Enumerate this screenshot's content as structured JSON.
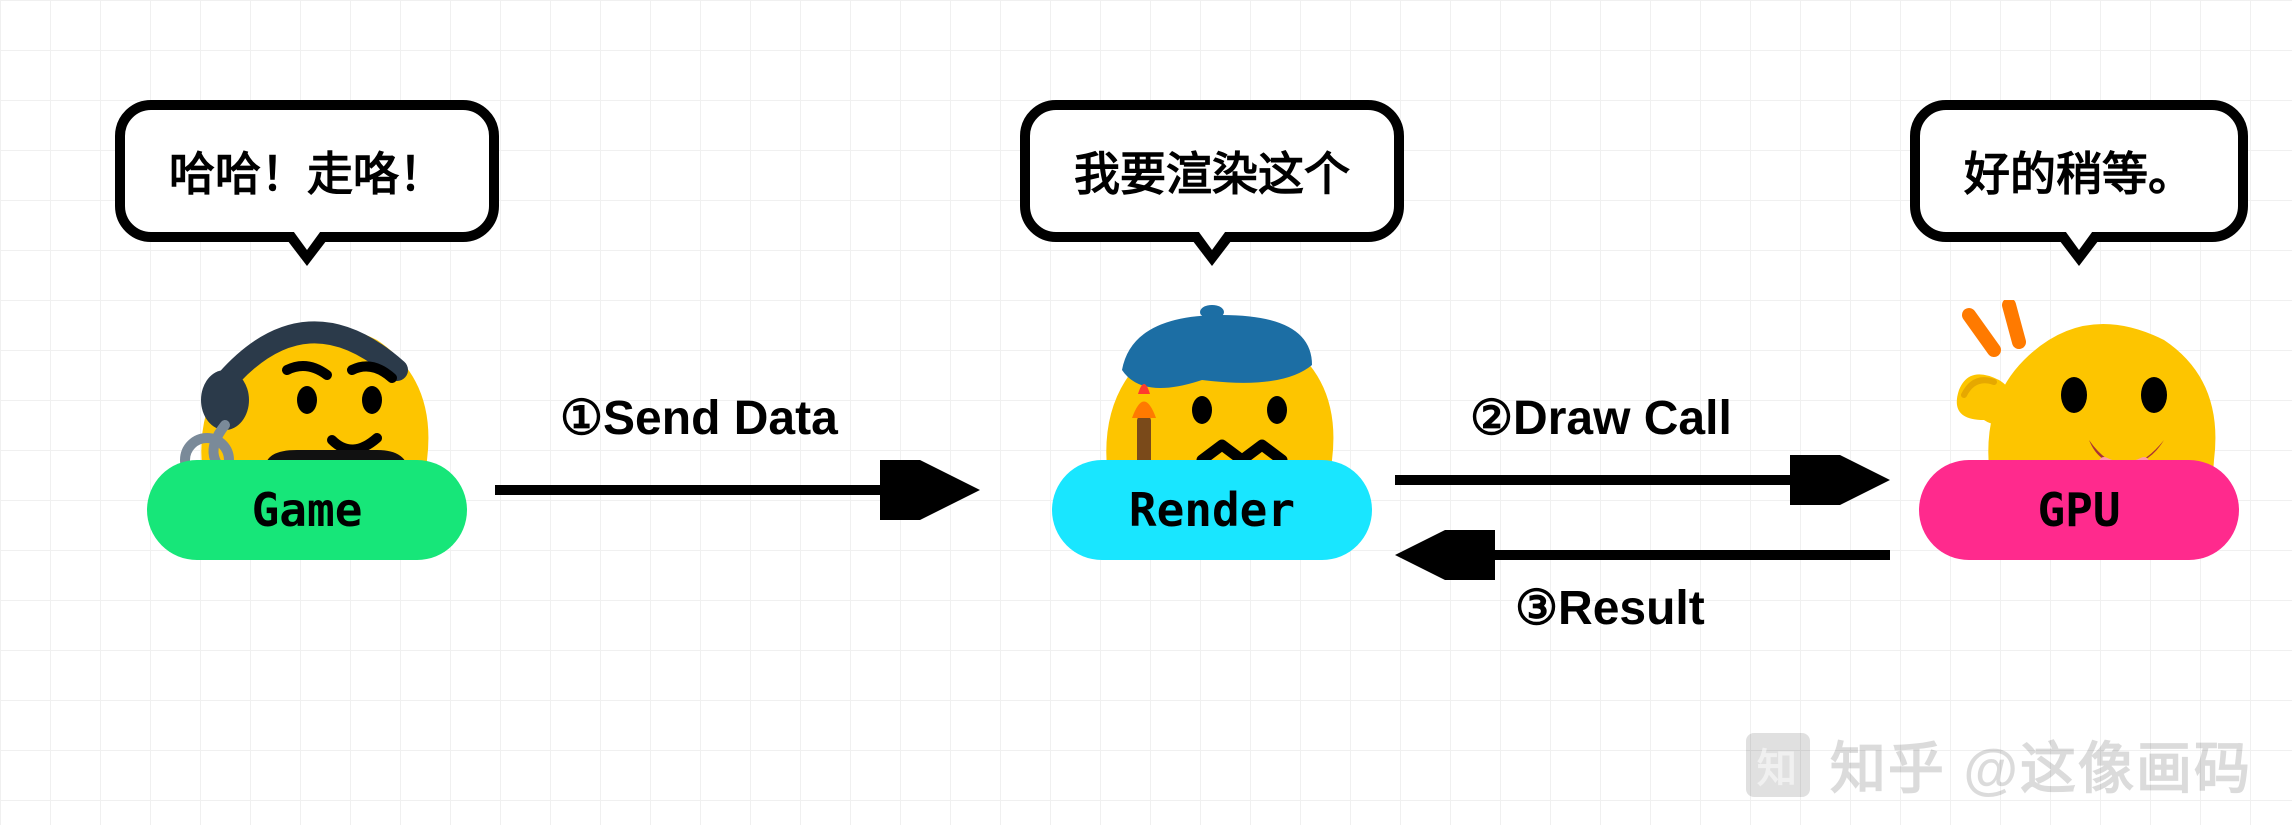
{
  "nodes": {
    "game": {
      "speech": "哈哈！走咯！",
      "label": "Game",
      "pill_color": "#17e679"
    },
    "render": {
      "speech": "我要渲染这个",
      "label": "Render",
      "pill_color": "#19e6ff"
    },
    "gpu": {
      "speech": "好的稍等。",
      "label": "GPU",
      "pill_color": "#ff2a8d"
    }
  },
  "arrows": {
    "send_data": "①Send Data",
    "draw_call": "②Draw Call",
    "result": "③Result"
  },
  "watermark": "知乎 @这像画码"
}
